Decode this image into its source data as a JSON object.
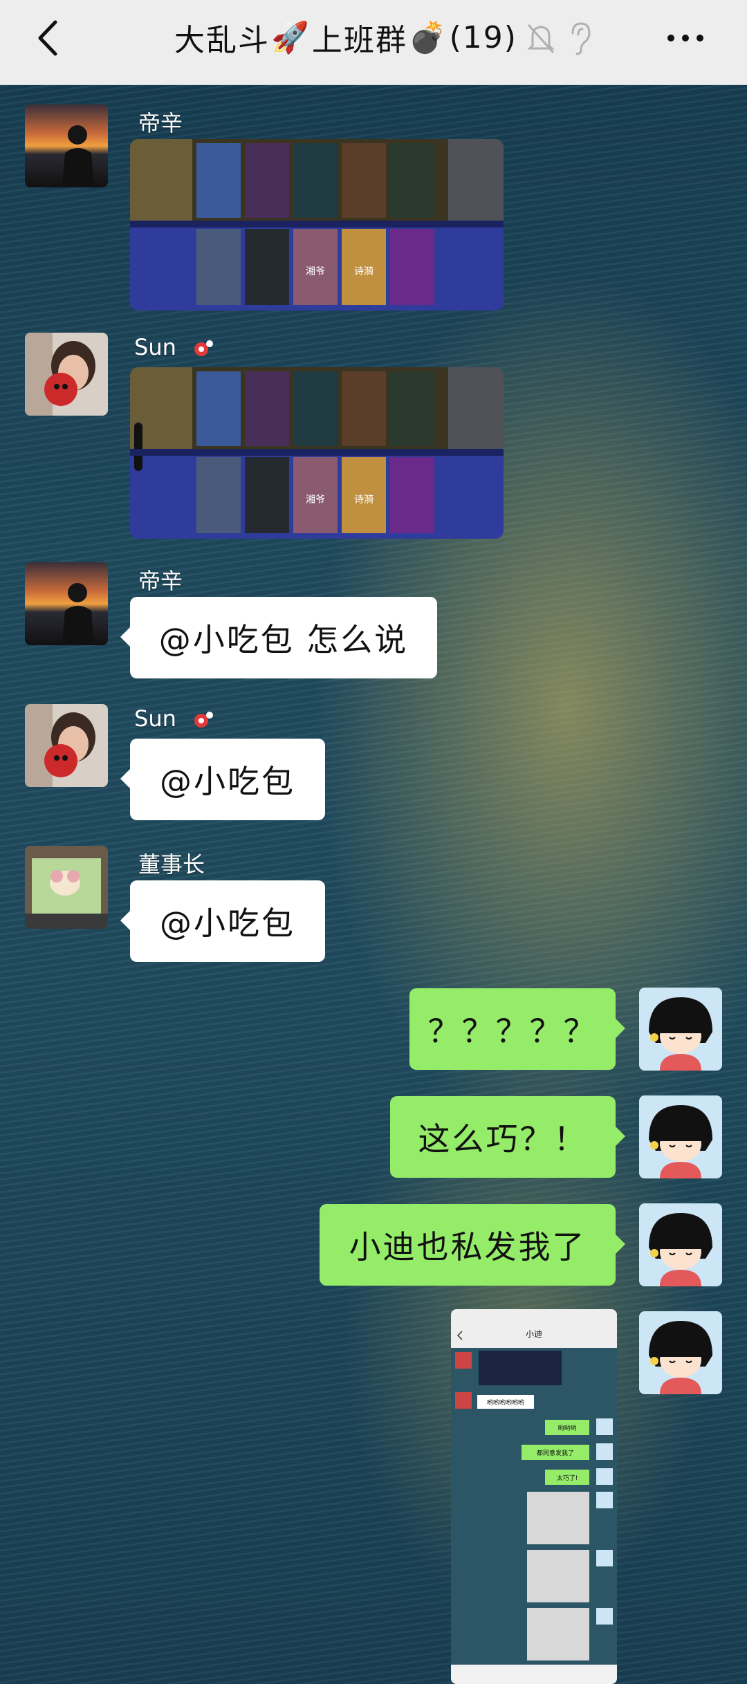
{
  "header": {
    "title_part1": "大乱斗",
    "title_emoji1": "🚀",
    "title_part2": "上班群",
    "title_emoji2": "💣",
    "member_count": "(19)",
    "icons": [
      "back-arrow-icon",
      "mute-bell-icon",
      "ear-icon",
      "more-icon"
    ]
  },
  "messages": [
    {
      "sender": "帝辛",
      "type": "image",
      "content": "hero-draft-screenshot"
    },
    {
      "sender": "Sun",
      "type": "image",
      "content": "hero-draft-screenshot"
    },
    {
      "sender": "帝辛",
      "type": "text",
      "text": "@小吃包  怎么说"
    },
    {
      "sender": "Sun",
      "type": "text",
      "text": "@小吃包"
    },
    {
      "sender": "董事长",
      "type": "text",
      "text": "@小吃包"
    },
    {
      "sender": "me",
      "type": "text",
      "text": "？？？？？"
    },
    {
      "sender": "me",
      "type": "text",
      "text": "这么巧？！"
    },
    {
      "sender": "me",
      "type": "text",
      "text": "小迪也私发我了"
    },
    {
      "sender": "me",
      "type": "image",
      "content": "chat-screenshot"
    }
  ],
  "draft_cards": {
    "top_row": [
      "",
      "",
      "",
      "",
      ""
    ],
    "bottom_row": [
      "",
      "",
      "湘爷",
      "诗漪",
      ""
    ]
  },
  "forwarded_shot": {
    "title": "小迪",
    "lines": [
      "哟哟哟哟哟哟",
      "哟哟哟",
      "都同意发我了",
      "太巧了!"
    ]
  },
  "colors": {
    "header_bg": "#ededed",
    "bubble_in": "#ffffff",
    "bubble_out": "#95ec69"
  }
}
